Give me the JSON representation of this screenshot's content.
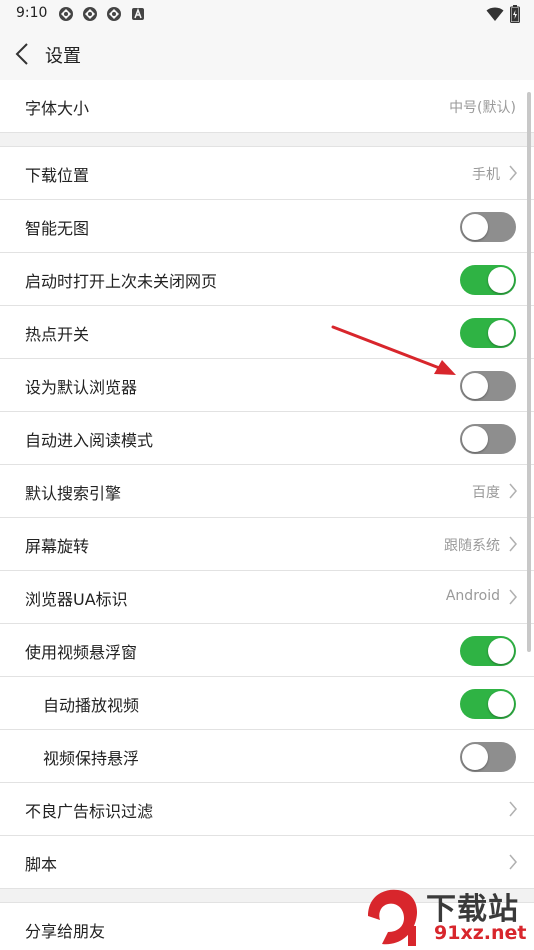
{
  "status_bar": {
    "time": "9:10",
    "icons": [
      "app-icon",
      "app-icon",
      "app-icon",
      "a-icon"
    ],
    "right_icons": [
      "wifi-icon",
      "battery-icon"
    ]
  },
  "header": {
    "back_icon": "chevron-left-icon",
    "title": "设置"
  },
  "settings": {
    "font_size": {
      "label": "字体大小",
      "value": "中号(默认)"
    },
    "download_location": {
      "label": "下载位置",
      "value": "手机"
    },
    "smart_no_image": {
      "label": "智能无图",
      "on": false
    },
    "restore_tabs": {
      "label": "启动时打开上次未关闭网页",
      "on": true
    },
    "hotspot": {
      "label": "热点开关",
      "on": true
    },
    "default_browser": {
      "label": "设为默认浏览器",
      "on": false
    },
    "auto_reading_mode": {
      "label": "自动进入阅读模式",
      "on": false
    },
    "search_engine": {
      "label": "默认搜索引擎",
      "value": "百度"
    },
    "screen_rotation": {
      "label": "屏幕旋转",
      "value": "跟随系统"
    },
    "ua": {
      "label": "浏览器UA标识",
      "value": "Android"
    },
    "floating_video": {
      "label": "使用视频悬浮窗",
      "on": true
    },
    "autoplay_video": {
      "label": "自动播放视频",
      "on": true
    },
    "keep_floating": {
      "label": "视频保持悬浮",
      "on": false
    },
    "ad_filter": {
      "label": "不良广告标识过滤"
    },
    "script": {
      "label": "脚本"
    },
    "share": {
      "label": "分享给朋友"
    }
  },
  "colors": {
    "toggle_on": "#2fb344",
    "toggle_off": "#8e8e8e",
    "annotation_arrow": "#d8262c"
  },
  "watermark": {
    "top_text": "下载站",
    "bottom_text": "91xz.net"
  }
}
